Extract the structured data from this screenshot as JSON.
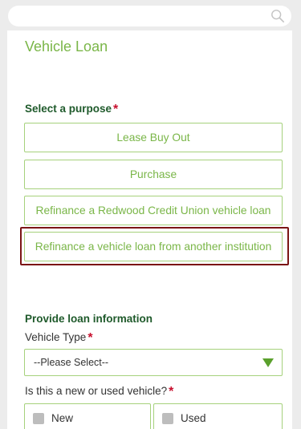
{
  "header": {
    "search_placeholder": ""
  },
  "page": {
    "title": "Vehicle Loan"
  },
  "purpose": {
    "heading": "Select a purpose",
    "required_mark": "*",
    "options": [
      {
        "label": "Lease Buy Out"
      },
      {
        "label": "Purchase"
      },
      {
        "label": "Refinance a Redwood Credit Union vehicle loan"
      },
      {
        "label": "Refinance a vehicle loan from another institution"
      }
    ],
    "highlighted_index": 3
  },
  "loan_info": {
    "heading": "Provide loan information",
    "vehicle_type": {
      "label": "Vehicle Type",
      "required_mark": "*",
      "selected": "--Please Select--"
    },
    "condition": {
      "label": "Is this a new or used vehicle?",
      "required_mark": "*",
      "options": [
        {
          "label": "New"
        },
        {
          "label": "Used"
        }
      ]
    }
  },
  "colors": {
    "accent_green": "#7ab648",
    "heading_green": "#1f5a2b",
    "required_red": "#c8102e",
    "highlight_border": "#7b1515"
  },
  "icons": {
    "search": "search-icon",
    "dropdown": "triangle-down-icon"
  }
}
